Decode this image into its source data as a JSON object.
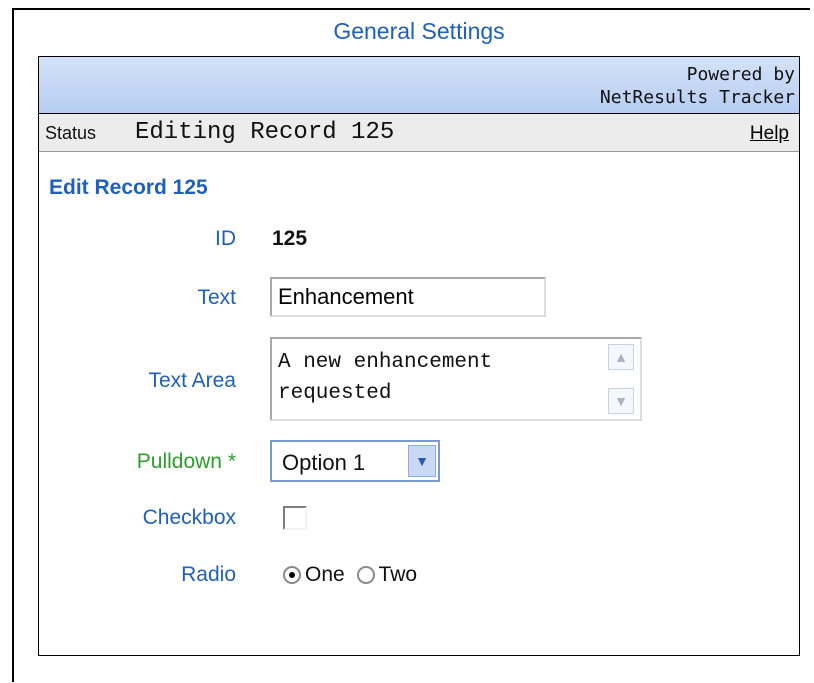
{
  "title": "General Settings",
  "header": {
    "powered_line1": "Powered by",
    "powered_line2": "NetResults Tracker"
  },
  "status": {
    "label": "Status",
    "text": "Editing Record 125",
    "help": "Help"
  },
  "section": {
    "title": "Edit Record 125"
  },
  "fields": {
    "id_label": "ID",
    "id_value": "125",
    "text_label": "Text",
    "text_value": "Enhancement",
    "textarea_label": "Text Area",
    "textarea_value": "A new enhancement\nrequested",
    "pulldown_label": "Pulldown *",
    "pulldown_value": "Option 1",
    "checkbox_label": "Checkbox",
    "radio_label": "Radio",
    "radio_option_one": "One",
    "radio_option_two": "Two"
  },
  "icons": {
    "scroll_up": "chevron-up-icon",
    "scroll_down": "chevron-down-icon",
    "dropdown": "chevron-down-icon"
  },
  "colors": {
    "accent": "#1f5fbf",
    "required": "#2aa02a"
  }
}
